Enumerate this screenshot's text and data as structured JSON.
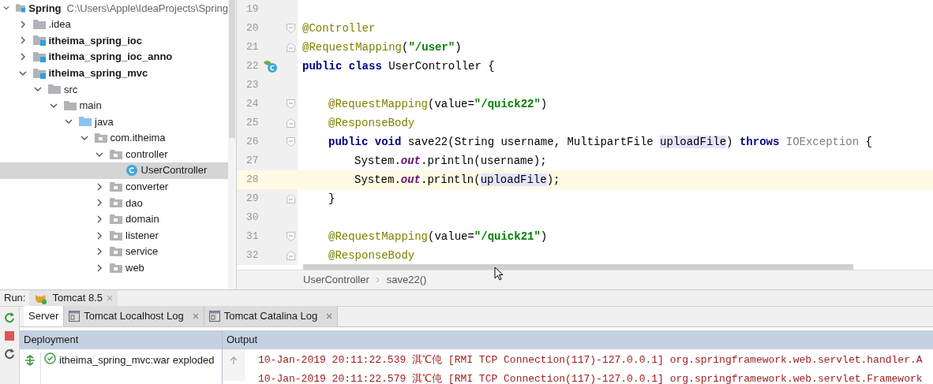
{
  "project_tree": [
    {
      "label": "Spring",
      "kind": "module",
      "bold": true,
      "path": "C:\\Users\\Apple\\IdeaProjects\\Spring",
      "expanded": true,
      "selected": false,
      "children": [
        {
          "label": ".idea",
          "kind": "folder",
          "expanded": false,
          "selected": false
        },
        {
          "label": "itheima_spring_ioc",
          "kind": "module",
          "bold": true,
          "expanded": false,
          "selected": false
        },
        {
          "label": "itheima_spring_ioc_anno",
          "kind": "module",
          "bold": true,
          "expanded": false,
          "selected": false
        },
        {
          "label": "itheima_spring_mvc",
          "kind": "module",
          "bold": true,
          "expanded": true,
          "selected": false,
          "children": [
            {
              "label": "src",
              "kind": "folder",
              "expanded": true,
              "selected": false,
              "children": [
                {
                  "label": "main",
                  "kind": "folder",
                  "expanded": true,
                  "selected": false,
                  "children": [
                    {
                      "label": "java",
                      "kind": "source_root",
                      "expanded": true,
                      "selected": false,
                      "children": [
                        {
                          "label": "com.itheima",
                          "kind": "package",
                          "expanded": true,
                          "selected": false,
                          "children": [
                            {
                              "label": "controller",
                              "kind": "package",
                              "expanded": true,
                              "selected": false,
                              "children": [
                                {
                                  "label": "UserController",
                                  "kind": "class",
                                  "selected": true
                                }
                              ]
                            },
                            {
                              "label": "converter",
                              "kind": "package",
                              "expanded": false,
                              "selected": false
                            },
                            {
                              "label": "dao",
                              "kind": "package",
                              "expanded": false,
                              "selected": false
                            },
                            {
                              "label": "domain",
                              "kind": "package",
                              "expanded": false,
                              "selected": false
                            },
                            {
                              "label": "listener",
                              "kind": "package",
                              "expanded": false,
                              "selected": false
                            },
                            {
                              "label": "service",
                              "kind": "package",
                              "expanded": false,
                              "selected": false
                            },
                            {
                              "label": "web",
                              "kind": "package",
                              "expanded": false,
                              "selected": false
                            }
                          ]
                        }
                      ]
                    }
                  ]
                }
              ]
            }
          ]
        }
      ]
    }
  ],
  "editor": {
    "lines": [
      {
        "number": "19",
        "kind": "top"
      },
      {
        "number": "20",
        "kind": "top",
        "fold_start": true,
        "tokens": [
          {
            "kind": "annotation",
            "text": "@Controller"
          }
        ]
      },
      {
        "number": "21",
        "kind": "top",
        "fold_end": true,
        "tokens": [
          {
            "kind": "annotation",
            "text": "@RequestMapping"
          },
          {
            "kind": "plain",
            "text": "("
          },
          {
            "kind": "string",
            "text": "\"/user\""
          },
          {
            "kind": "plain",
            "text": ")"
          }
        ]
      },
      {
        "number": "22",
        "kind": "top",
        "bean_icon": true,
        "tokens": [
          {
            "kind": "keyword",
            "text": "public class "
          },
          {
            "kind": "plain",
            "text": "UserController {"
          }
        ]
      },
      {
        "number": "23",
        "kind": "top"
      },
      {
        "number": "24",
        "fold_start": true,
        "kind": "member",
        "tokens": [
          {
            "kind": "annotation",
            "text": "@RequestMapping"
          },
          {
            "kind": "plain",
            "text": "(value="
          },
          {
            "kind": "string",
            "text": "\"/quick22\""
          },
          {
            "kind": "plain",
            "text": ")"
          }
        ]
      },
      {
        "number": "25",
        "fold_end": true,
        "kind": "member",
        "tokens": [
          {
            "kind": "annotation",
            "text": "@ResponseBody"
          }
        ]
      },
      {
        "number": "26",
        "fold_start": true,
        "kind": "member",
        "tokens": [
          {
            "kind": "keyword",
            "text": "public void "
          },
          {
            "kind": "plain",
            "text": "save22(String username, MultipartFile "
          },
          {
            "kind": "highlight",
            "text": "uploadFile"
          },
          {
            "kind": "plain",
            "text": ") "
          },
          {
            "kind": "keyword",
            "text": "throws "
          },
          {
            "kind": "unused",
            "text": "IOException"
          },
          {
            "kind": "plain",
            "text": " {"
          }
        ]
      },
      {
        "number": "27",
        "kind": "body",
        "tokens": [
          {
            "kind": "plain",
            "text": "System."
          },
          {
            "kind": "field",
            "text": "out"
          },
          {
            "kind": "plain",
            "text": ".println(username);"
          }
        ]
      },
      {
        "number": "28",
        "kind": "body",
        "current": true,
        "tokens": [
          {
            "kind": "plain",
            "text": "System."
          },
          {
            "kind": "field",
            "text": "out"
          },
          {
            "kind": "plain",
            "text": ".println("
          },
          {
            "kind": "highlight",
            "text": "uploadFile"
          },
          {
            "kind": "plain",
            "text": ");"
          }
        ]
      },
      {
        "number": "29",
        "fold_end": true,
        "kind": "member",
        "tokens": [
          {
            "kind": "plain",
            "text": "}"
          }
        ]
      },
      {
        "number": "30",
        "kind": "top"
      },
      {
        "number": "31",
        "fold_start": true,
        "kind": "member",
        "tokens": [
          {
            "kind": "annotation",
            "text": "@RequestMapping"
          },
          {
            "kind": "plain",
            "text": "(value="
          },
          {
            "kind": "string",
            "text": "\"/quick21\""
          },
          {
            "kind": "plain",
            "text": ")"
          }
        ]
      },
      {
        "number": "32",
        "fold_end": true,
        "kind": "member",
        "tokens": [
          {
            "kind": "annotation",
            "text": "@ResponseBody"
          }
        ]
      }
    ],
    "breadcrumbs": [
      "UserController",
      "save22()"
    ]
  },
  "run_panel": {
    "label": "Run:",
    "config_tab": "Tomcat 8.5",
    "tabs": [
      {
        "label": "Server",
        "selected": true,
        "closable": false
      },
      {
        "label": "Tomcat Localhost Log",
        "selected": false,
        "closable": true
      },
      {
        "label": "Tomcat Catalina Log",
        "selected": false,
        "closable": true
      }
    ],
    "columns": [
      "Deployment",
      "Output"
    ],
    "deployment": "itheima_spring_mvc:war exploded",
    "log_lines": [
      "10-Jan-2019 20:11:22.539 淇℃伅 [RMI TCP Connection(117)-127.0.0.1] org.springframework.web.servlet.handler.A",
      "10-Jan-2019 20:11:22.579 淇℃伅 [RMI TCP Connection(117)-127.0.0.1] org.springframework.web.servlet.Framework"
    ]
  }
}
